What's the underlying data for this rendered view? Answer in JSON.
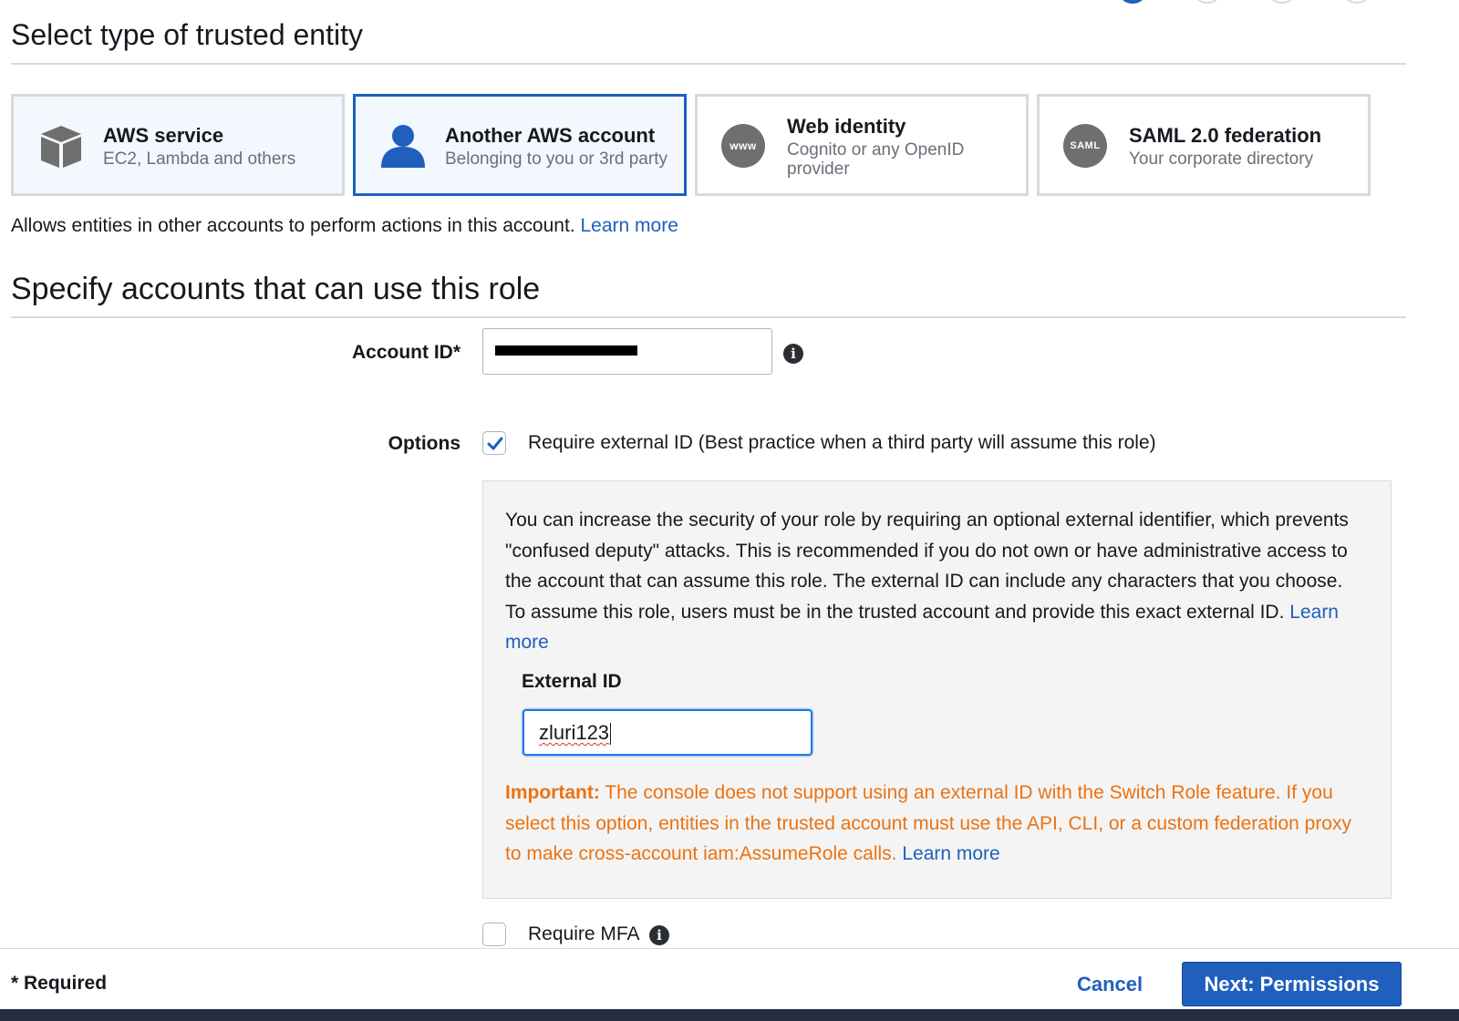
{
  "section1": {
    "title": "Select type of trusted entity",
    "cards": [
      {
        "title": "AWS service",
        "subtitle": "EC2, Lambda and others",
        "icon": "cube-icon"
      },
      {
        "title": "Another AWS account",
        "subtitle": "Belonging to you or 3rd party",
        "icon": "user-icon",
        "selected": true
      },
      {
        "title": "Web identity",
        "subtitle": "Cognito or any OpenID provider",
        "icon": "www-icon",
        "icon_text": "www"
      },
      {
        "title": "SAML 2.0 federation",
        "subtitle": "Your corporate directory",
        "icon": "saml-icon",
        "icon_text": "SAML"
      }
    ],
    "description": "Allows entities in other accounts to perform actions in this account.",
    "learn_more": "Learn more"
  },
  "section2": {
    "title": "Specify accounts that can use this role",
    "account_id_label": "Account ID*",
    "options_label": "Options",
    "require_external_id": {
      "label": "Require external ID (Best practice when a third party will assume this role)",
      "checked": true
    },
    "panel": {
      "text": "You can increase the security of your role by requiring an optional external identifier, which prevents \"confused deputy\" attacks. This is recommended if you do not own or have administrative access to the account that can assume this role. The external ID can include any characters that you choose. To assume this role, users must be in the trusted account and provide this exact external ID.",
      "learn_more": "Learn more",
      "external_id_label": "External ID",
      "external_id_value": "zluri123",
      "important_label": "Important:",
      "important_text": "The console does not support using an external ID with the Switch Role feature. If you select this option, entities in the trusted account must use the API, CLI, or a custom federation proxy to make cross-account iam:AssumeRole calls.",
      "important_learn_more": "Learn more"
    },
    "require_mfa": {
      "label": "Require MFA",
      "checked": false
    }
  },
  "footer": {
    "required_note": "* Required",
    "cancel_label": "Cancel",
    "next_label": "Next: Permissions"
  },
  "colors": {
    "accent": "#1f5fbe",
    "warning": "#ec7211"
  }
}
